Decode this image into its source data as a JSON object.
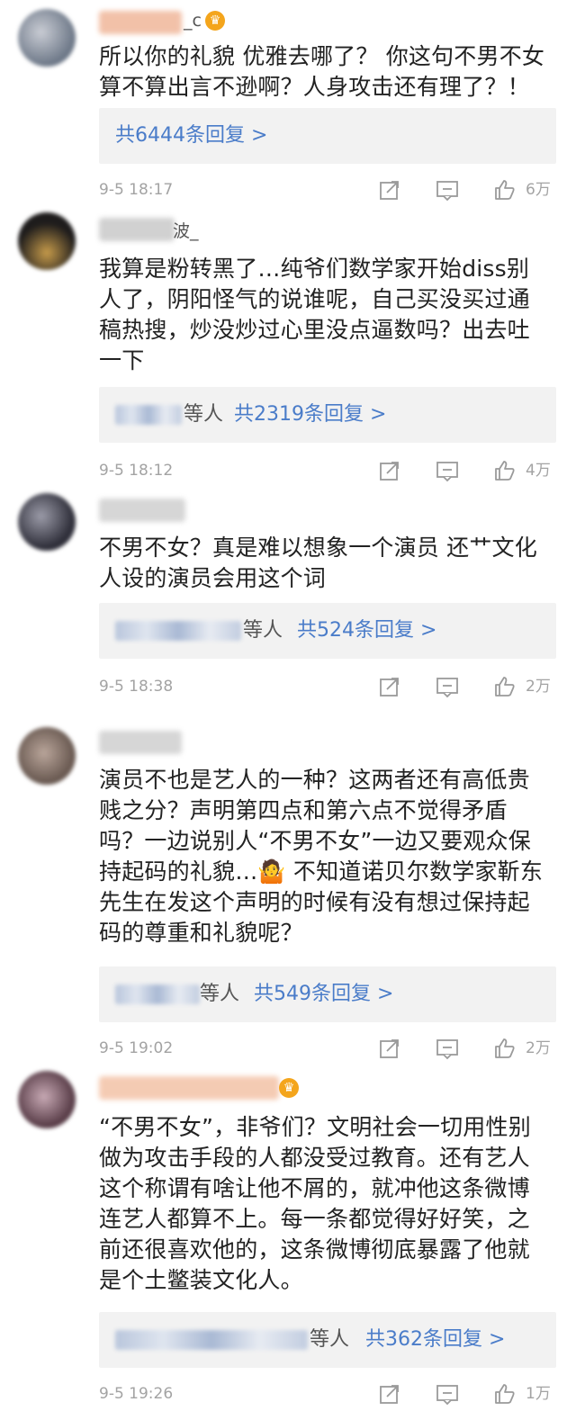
{
  "comments": [
    {
      "name_suffix": "_c",
      "text": "所以你的礼貌 优雅去哪了？ 你这句不男不女算不算出言不逊啊？人身攻击还有理了？！",
      "reply_prefix": "",
      "reply_count": "共6444条回复 >",
      "time": "9-5 18:17",
      "likes": "6万",
      "avatar_colors": [
        "#6b7686",
        "#c9ccd4"
      ],
      "name_color": "#f0b79a",
      "has_crown": true
    },
    {
      "name_suffix": "波_",
      "text": "我算是粉转黑了…纯爷们数学家开始diss别人了，阴阳怪气的说谁呢，自己买没买过通稿热搜，炒没炒过心里没点逼数吗？出去吐一下",
      "reply_prefix": "等人",
      "reply_count": "共2319条回复 >",
      "time": "9-5 18:12",
      "likes": "4万",
      "avatar_colors": [
        "#1e1c1c",
        "#c59a4a"
      ],
      "name_color": "#c9c9c9",
      "has_crown": false
    },
    {
      "name_suffix": "",
      "text": "不男不女？真是难以想象一个演员 还艹文化人设的演员会用这个词",
      "reply_prefix": "等人",
      "reply_count": "共524条回复 >",
      "time": "9-5 18:38",
      "likes": "2万",
      "avatar_colors": [
        "#2f2f3a",
        "#9b9ba8"
      ],
      "name_color": "#cfcfcf",
      "has_crown": false
    },
    {
      "name_suffix": "",
      "text": "演员不也是艺人的一种？这两者还有高低贵贱之分？声明第四点和第六点不觉得矛盾吗？一边说别人“不男不女”一边又要观众保持起码的礼貌…🤷 不知道诺贝尔数学家靳东先生在发这个声明的时候有没有想过保持起码的尊重和礼貌呢？",
      "reply_prefix": "等人",
      "reply_count": "共549条回复 >",
      "time": "9-5 19:02",
      "likes": "2万",
      "avatar_colors": [
        "#6a5a52",
        "#b9a59a"
      ],
      "name_color": "#cfcfcf",
      "has_crown": false
    },
    {
      "name_suffix": "",
      "text": "“不男不女”，非爷们？文明社会一切用性别做为攻击手段的人都没受过教育。还有艺人这个称谓有啥让他不屑的，就冲他这条微博连艺人都算不上。每一条都觉得好好笑，之前还很喜欢他的，这条微博彻底暴露了他就是个土鳖装文化人。",
      "reply_prefix": "等人",
      "reply_count": "共362条回复 >",
      "time": "9-5 19:26",
      "likes": "1万",
      "avatar_colors": [
        "#5a3e49",
        "#c7a9b4"
      ],
      "name_color": "#f3c2a6",
      "has_crown": true
    }
  ],
  "icons": {
    "share": "share-icon",
    "comment": "comment-icon",
    "like": "like-icon"
  }
}
